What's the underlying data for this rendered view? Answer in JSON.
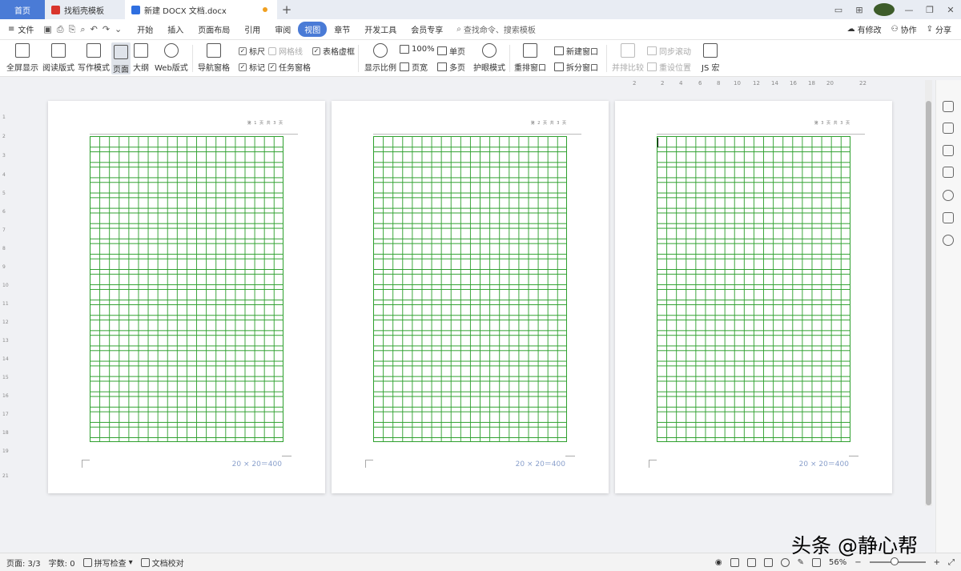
{
  "tabs": {
    "home": "首页",
    "template_tab": "找稻壳模板",
    "doc_tab": "新建 DOCX 文档.docx",
    "new_tab": "+"
  },
  "menubar": {
    "file": "文件",
    "items": [
      "开始",
      "插入",
      "页面布局",
      "引用",
      "审阅",
      "视图",
      "章节",
      "开发工具",
      "会员专享"
    ],
    "active": "视图",
    "search_placeholder": "查找命令、搜索模板",
    "right": [
      "有修改",
      "协作",
      "分享"
    ]
  },
  "ribbon": {
    "fullscreen": "全屏显示",
    "read_mode": "阅读版式",
    "write_mode": "写作模式",
    "page_view": "页面",
    "outline": "大纲",
    "web": "Web版式",
    "nav_pane": "导航窗格",
    "ruler": "标尺",
    "gridlines": "网格线",
    "table_gridlines": "表格虚框",
    "marks": "标记",
    "task_pane": "任务窗格",
    "zoom": "显示比例",
    "hundred": "100%",
    "page_width": "页宽",
    "single_page": "单页",
    "multi_page": "多页",
    "eye_mode": "护眼模式",
    "rearrange": "重排窗口",
    "new_window": "新建窗口",
    "split_window": "拆分窗口",
    "side_by_side": "并排比较",
    "sync_scroll": "同步滚动",
    "reset_pos": "重设位置",
    "js_macro": "JS 宏"
  },
  "ruler": {
    "h_ticks": [
      "2",
      "2",
      "4",
      "6",
      "8",
      "10",
      "12",
      "14",
      "16",
      "18",
      "20",
      "22"
    ],
    "v_ticks": [
      "1",
      "2",
      "3",
      "4",
      "5",
      "6",
      "7",
      "8",
      "9",
      "10",
      "11",
      "12",
      "13",
      "14",
      "15",
      "16",
      "17",
      "18",
      "19",
      "21"
    ]
  },
  "pages": [
    {
      "header": "第 1 页 共 3 页",
      "footer": "20 × 20＝400"
    },
    {
      "header": "第 2 页 共 3 页",
      "footer": "20 × 20＝400"
    },
    {
      "header": "第 3 页 共 3 页",
      "footer": "20 × 20＝400"
    }
  ],
  "status": {
    "page": "页面: 3/3",
    "words": "字数: 0",
    "spell": "拼写检查",
    "proof": "文档校对",
    "zoom": "56%"
  },
  "watermark": "头条 @静心帮"
}
